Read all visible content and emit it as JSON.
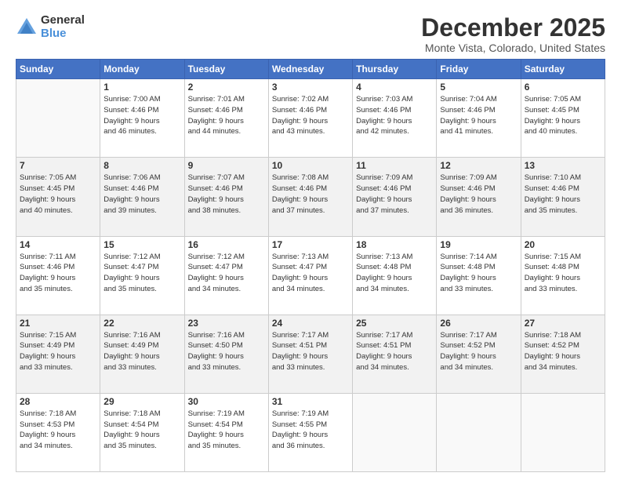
{
  "logo": {
    "general": "General",
    "blue": "Blue"
  },
  "header": {
    "month": "December 2025",
    "location": "Monte Vista, Colorado, United States"
  },
  "days": [
    "Sunday",
    "Monday",
    "Tuesday",
    "Wednesday",
    "Thursday",
    "Friday",
    "Saturday"
  ],
  "weeks": [
    [
      {
        "day": "",
        "info": ""
      },
      {
        "day": "1",
        "info": "Sunrise: 7:00 AM\nSunset: 4:46 PM\nDaylight: 9 hours\nand 46 minutes."
      },
      {
        "day": "2",
        "info": "Sunrise: 7:01 AM\nSunset: 4:46 PM\nDaylight: 9 hours\nand 44 minutes."
      },
      {
        "day": "3",
        "info": "Sunrise: 7:02 AM\nSunset: 4:46 PM\nDaylight: 9 hours\nand 43 minutes."
      },
      {
        "day": "4",
        "info": "Sunrise: 7:03 AM\nSunset: 4:46 PM\nDaylight: 9 hours\nand 42 minutes."
      },
      {
        "day": "5",
        "info": "Sunrise: 7:04 AM\nSunset: 4:46 PM\nDaylight: 9 hours\nand 41 minutes."
      },
      {
        "day": "6",
        "info": "Sunrise: 7:05 AM\nSunset: 4:45 PM\nDaylight: 9 hours\nand 40 minutes."
      }
    ],
    [
      {
        "day": "7",
        "info": "Sunrise: 7:05 AM\nSunset: 4:45 PM\nDaylight: 9 hours\nand 40 minutes."
      },
      {
        "day": "8",
        "info": "Sunrise: 7:06 AM\nSunset: 4:46 PM\nDaylight: 9 hours\nand 39 minutes."
      },
      {
        "day": "9",
        "info": "Sunrise: 7:07 AM\nSunset: 4:46 PM\nDaylight: 9 hours\nand 38 minutes."
      },
      {
        "day": "10",
        "info": "Sunrise: 7:08 AM\nSunset: 4:46 PM\nDaylight: 9 hours\nand 37 minutes."
      },
      {
        "day": "11",
        "info": "Sunrise: 7:09 AM\nSunset: 4:46 PM\nDaylight: 9 hours\nand 37 minutes."
      },
      {
        "day": "12",
        "info": "Sunrise: 7:09 AM\nSunset: 4:46 PM\nDaylight: 9 hours\nand 36 minutes."
      },
      {
        "day": "13",
        "info": "Sunrise: 7:10 AM\nSunset: 4:46 PM\nDaylight: 9 hours\nand 35 minutes."
      }
    ],
    [
      {
        "day": "14",
        "info": "Sunrise: 7:11 AM\nSunset: 4:46 PM\nDaylight: 9 hours\nand 35 minutes."
      },
      {
        "day": "15",
        "info": "Sunrise: 7:12 AM\nSunset: 4:47 PM\nDaylight: 9 hours\nand 35 minutes."
      },
      {
        "day": "16",
        "info": "Sunrise: 7:12 AM\nSunset: 4:47 PM\nDaylight: 9 hours\nand 34 minutes."
      },
      {
        "day": "17",
        "info": "Sunrise: 7:13 AM\nSunset: 4:47 PM\nDaylight: 9 hours\nand 34 minutes."
      },
      {
        "day": "18",
        "info": "Sunrise: 7:13 AM\nSunset: 4:48 PM\nDaylight: 9 hours\nand 34 minutes."
      },
      {
        "day": "19",
        "info": "Sunrise: 7:14 AM\nSunset: 4:48 PM\nDaylight: 9 hours\nand 33 minutes."
      },
      {
        "day": "20",
        "info": "Sunrise: 7:15 AM\nSunset: 4:48 PM\nDaylight: 9 hours\nand 33 minutes."
      }
    ],
    [
      {
        "day": "21",
        "info": "Sunrise: 7:15 AM\nSunset: 4:49 PM\nDaylight: 9 hours\nand 33 minutes."
      },
      {
        "day": "22",
        "info": "Sunrise: 7:16 AM\nSunset: 4:49 PM\nDaylight: 9 hours\nand 33 minutes."
      },
      {
        "day": "23",
        "info": "Sunrise: 7:16 AM\nSunset: 4:50 PM\nDaylight: 9 hours\nand 33 minutes."
      },
      {
        "day": "24",
        "info": "Sunrise: 7:17 AM\nSunset: 4:51 PM\nDaylight: 9 hours\nand 33 minutes."
      },
      {
        "day": "25",
        "info": "Sunrise: 7:17 AM\nSunset: 4:51 PM\nDaylight: 9 hours\nand 34 minutes."
      },
      {
        "day": "26",
        "info": "Sunrise: 7:17 AM\nSunset: 4:52 PM\nDaylight: 9 hours\nand 34 minutes."
      },
      {
        "day": "27",
        "info": "Sunrise: 7:18 AM\nSunset: 4:52 PM\nDaylight: 9 hours\nand 34 minutes."
      }
    ],
    [
      {
        "day": "28",
        "info": "Sunrise: 7:18 AM\nSunset: 4:53 PM\nDaylight: 9 hours\nand 34 minutes."
      },
      {
        "day": "29",
        "info": "Sunrise: 7:18 AM\nSunset: 4:54 PM\nDaylight: 9 hours\nand 35 minutes."
      },
      {
        "day": "30",
        "info": "Sunrise: 7:19 AM\nSunset: 4:54 PM\nDaylight: 9 hours\nand 35 minutes."
      },
      {
        "day": "31",
        "info": "Sunrise: 7:19 AM\nSunset: 4:55 PM\nDaylight: 9 hours\nand 36 minutes."
      },
      {
        "day": "",
        "info": ""
      },
      {
        "day": "",
        "info": ""
      },
      {
        "day": "",
        "info": ""
      }
    ]
  ]
}
